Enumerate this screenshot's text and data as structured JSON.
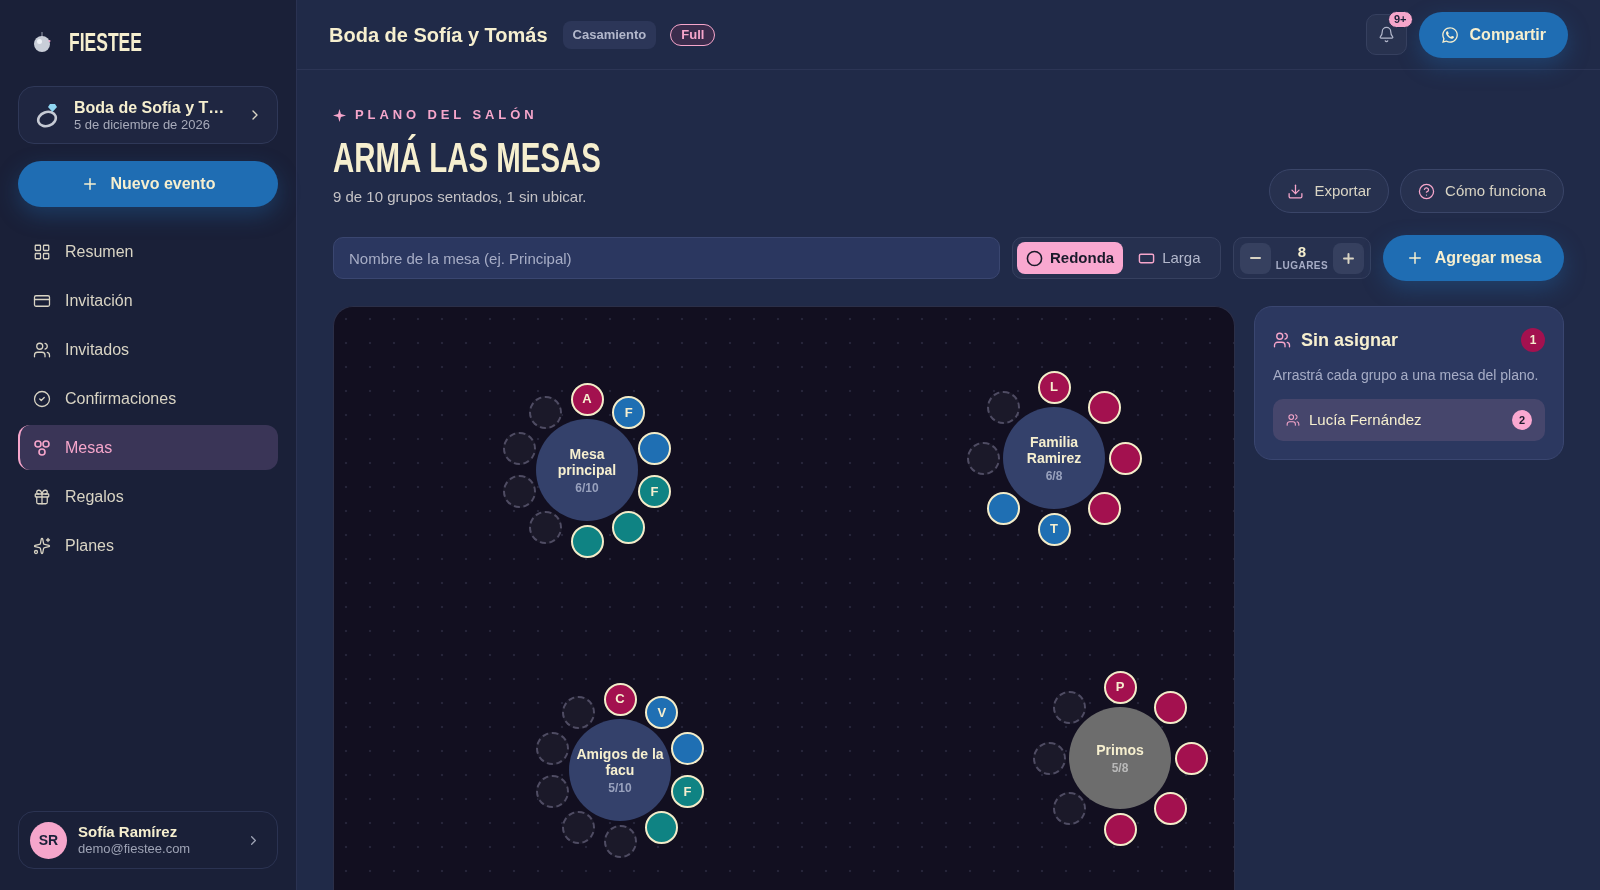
{
  "sidebar": {
    "logo": "FIESTEE",
    "event_card": {
      "title": "Boda de Sofía y T…",
      "date": "5 de diciembre de 2026"
    },
    "new_event_button": "Nuevo evento",
    "nav": [
      {
        "label": "Resumen",
        "selected": false
      },
      {
        "label": "Invitación",
        "selected": false
      },
      {
        "label": "Invitados",
        "selected": false
      },
      {
        "label": "Confirmaciones",
        "selected": false
      },
      {
        "label": "Mesas",
        "selected": true
      },
      {
        "label": "Regalos",
        "selected": false
      },
      {
        "label": "Planes",
        "selected": false
      }
    ],
    "user": {
      "initials": "SR",
      "name": "Sofía Ramírez",
      "email": "demo@fiestee.com"
    }
  },
  "header": {
    "title": "Boda de Sofía y Tomás",
    "tags": [
      {
        "label": "Casamiento",
        "kind": "neutral"
      },
      {
        "label": "Full",
        "kind": "outline"
      }
    ],
    "notifications_badge": "9+",
    "share_button": "Compartir"
  },
  "page": {
    "eyebrow": "PLANO DEL SALÓN",
    "title": "ARMÁ LAS MESAS",
    "subtitle": "9 de 10 grupos sentados, 1 sin ubicar.",
    "actions": [
      {
        "label": "Exportar"
      },
      {
        "label": "Cómo funciona"
      }
    ]
  },
  "toolbar": {
    "name_field": {
      "placeholder": "Nombre de la mesa (ej. Principal)"
    },
    "shapes": [
      {
        "label": "Redonda",
        "selected": true
      },
      {
        "label": "Larga",
        "selected": false
      }
    ],
    "seats": {
      "value": "8",
      "label": "LUGARES"
    },
    "add_button": "Agregar mesa"
  },
  "floor_plan": {
    "tables": [
      {
        "name": "Mesa principal",
        "count": "6/10",
        "selected": false,
        "seats": [
          {
            "occupied": true,
            "color": "#a3114f",
            "initial": "A"
          },
          {
            "occupied": true,
            "color": "#1f6fb3",
            "initial": "F"
          },
          {
            "occupied": true,
            "color": "#1f6fb3"
          },
          {
            "occupied": true,
            "color": "#0f8383",
            "initial": "F"
          },
          {
            "occupied": true,
            "color": "#0f8383"
          },
          {
            "occupied": true,
            "color": "#0f8383"
          },
          {
            "occupied": false
          },
          {
            "occupied": false
          },
          {
            "occupied": false
          },
          {
            "occupied": false
          }
        ]
      },
      {
        "name": "Familia Ramirez",
        "count": "6/8",
        "selected": false,
        "seats": [
          {
            "occupied": true,
            "color": "#a3114f",
            "initial": "L"
          },
          {
            "occupied": true,
            "color": "#a3114f"
          },
          {
            "occupied": true,
            "color": "#a3114f"
          },
          {
            "occupied": true,
            "color": "#a3114f"
          },
          {
            "occupied": true,
            "color": "#1f6fb3",
            "initial": "T"
          },
          {
            "occupied": true,
            "color": "#1f6fb3"
          },
          {
            "occupied": false
          },
          {
            "occupied": false
          }
        ]
      },
      {
        "name": "Amigos de la facu",
        "count": "5/10",
        "selected": false,
        "seats": [
          {
            "occupied": true,
            "color": "#a3114f",
            "initial": "C"
          },
          {
            "occupied": true,
            "color": "#1f6fb3",
            "initial": "V"
          },
          {
            "occupied": true,
            "color": "#1f6fb3"
          },
          {
            "occupied": true,
            "color": "#0f8383",
            "initial": "F"
          },
          {
            "occupied": true,
            "color": "#0f8383"
          },
          {
            "occupied": false
          },
          {
            "occupied": false
          },
          {
            "occupied": false
          },
          {
            "occupied": false
          },
          {
            "occupied": false
          }
        ]
      },
      {
        "name": "Primos",
        "count": "5/8",
        "selected": true,
        "seats": [
          {
            "occupied": true,
            "color": "#a3114f",
            "initial": "P"
          },
          {
            "occupied": true,
            "color": "#a3114f"
          },
          {
            "occupied": true,
            "color": "#a3114f"
          },
          {
            "occupied": true,
            "color": "#a3114f"
          },
          {
            "occupied": true,
            "color": "#a3114f"
          },
          {
            "occupied": false
          },
          {
            "occupied": false
          },
          {
            "occupied": false
          }
        ]
      }
    ]
  },
  "unassigned": {
    "title": "Sin asignar",
    "count": "1",
    "hint": "Arrastrá cada grupo a una mesa del plano.",
    "groups": [
      {
        "name": "Lucía Fernández",
        "count": "2"
      }
    ]
  }
}
